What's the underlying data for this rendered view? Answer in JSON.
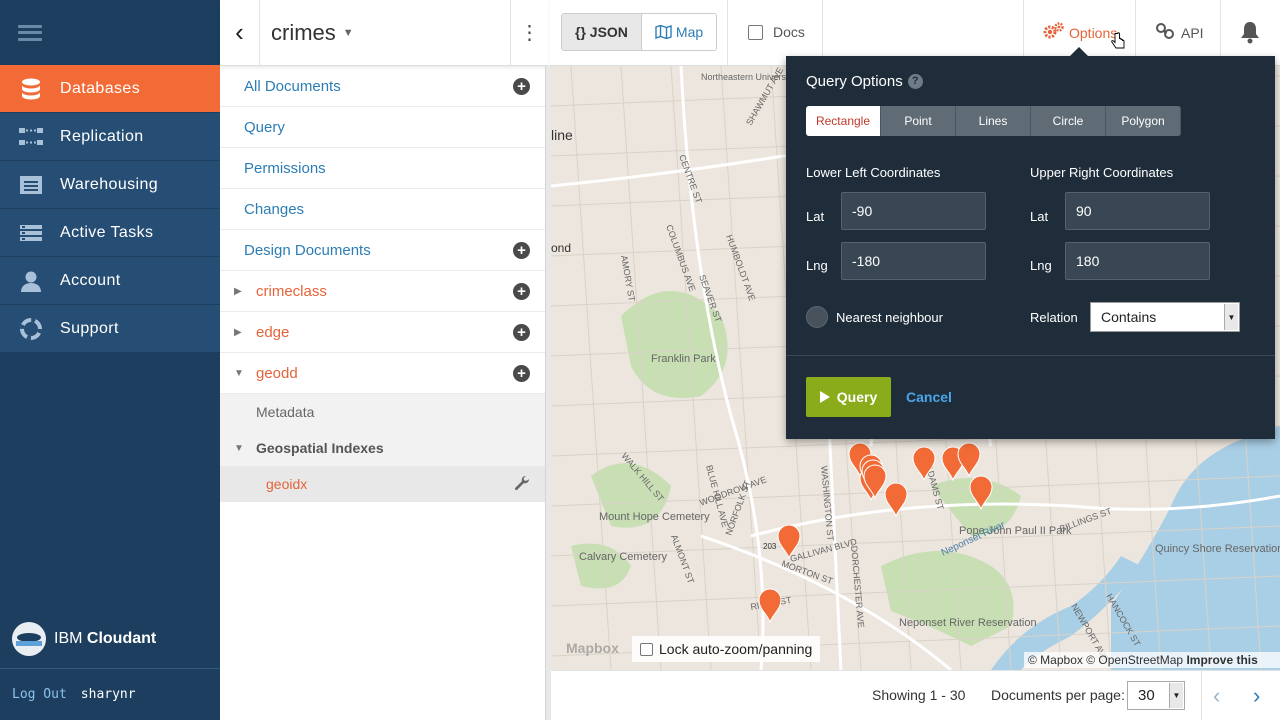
{
  "nav": {
    "items": [
      {
        "label": "Databases",
        "active": true
      },
      {
        "label": "Replication",
        "active": false
      },
      {
        "label": "Warehousing",
        "active": false
      },
      {
        "label": "Active Tasks",
        "active": false
      },
      {
        "label": "Account",
        "active": false
      },
      {
        "label": "Support",
        "active": false
      }
    ],
    "brand_prefix": "IBM",
    "brand_name": "Cloudant",
    "logout_label": "Log Out",
    "username": "sharynr"
  },
  "sidebar": {
    "db_name": "crimes",
    "rows": [
      {
        "label": "All Documents",
        "has_add": true
      },
      {
        "label": "Query",
        "has_add": false
      },
      {
        "label": "Permissions",
        "has_add": false
      },
      {
        "label": "Changes",
        "has_add": false
      },
      {
        "label": "Design Documents",
        "has_add": true
      }
    ],
    "design_docs": [
      {
        "label": "crimeclass",
        "expanded": false
      },
      {
        "label": "edge",
        "expanded": false
      },
      {
        "label": "geodd",
        "expanded": true
      }
    ],
    "metadata_label": "Metadata",
    "geo_indexes_label": "Geospatial Indexes",
    "selected_index": "geoidx"
  },
  "toolbar": {
    "json_label": "JSON",
    "json_prefix": "{}",
    "map_label": "Map",
    "docs_label": "Docs",
    "options_label": "Options",
    "api_label": "API"
  },
  "popup": {
    "title": "Query Options",
    "shapes": [
      "Rectangle",
      "Point",
      "Lines",
      "Circle",
      "Polygon"
    ],
    "active_shape": "Rectangle",
    "lower_left_heading": "Lower Left Coordinates",
    "upper_right_heading": "Upper Right Coordinates",
    "lat_label": "Lat",
    "lng_label": "Lng",
    "lower_left": {
      "lat": "-90",
      "lng": "-180"
    },
    "upper_right": {
      "lat": "90",
      "lng": "180"
    },
    "nearest_label": "Nearest neighbour",
    "relation_label": "Relation",
    "relation_value": "Contains",
    "query_label": "Query",
    "cancel_label": "Cancel"
  },
  "map": {
    "lock_label": "Lock auto-zoom/panning",
    "attrib_mapbox": "© Mapbox",
    "attrib_osm": "© OpenStreetMap",
    "attrib_improve": "Improve this map",
    "watermark": "Mapbox",
    "labels": [
      "Northeastern University",
      "Franklin Park",
      "Mount Hope Cemetery",
      "Calvary Cemetery",
      "Pope John Paul II Park",
      "Quincy Shore Reservation",
      "Neponset River Reservation",
      "Neponset River",
      "GALLIVAN BLVD",
      "WOODROW AVE",
      "MORTON ST",
      "BILLINGS ST",
      "HANCOCK ST",
      "NEWPORT AVE",
      "WASHINGTON ST",
      "DORCHESTER AVE",
      "ADAMS ST",
      "CENTRE ST",
      "SEAVER ST",
      "HUMBOLDT AVE",
      "COLUMBUS AVE",
      "AMORY ST",
      "WALK HILL ST",
      "BLUE HILL AVE",
      "NORFOLK ST",
      "ALMONT ST",
      "RIVER ST",
      "SHAWMUT AVE",
      "203",
      "line",
      "ond"
    ]
  },
  "footer": {
    "showing": "Showing 1 - 30",
    "per_page_label": "Documents per page:",
    "per_page_value": "30"
  },
  "colors": {
    "nav_bg": "#1d3e5e",
    "nav_item_bg": "#264d73",
    "accent": "#f26b36",
    "link": "#2d7db5",
    "popup_bg": "#1f2d3b",
    "query_btn": "#8aac1a",
    "marker": "#f26b36"
  }
}
